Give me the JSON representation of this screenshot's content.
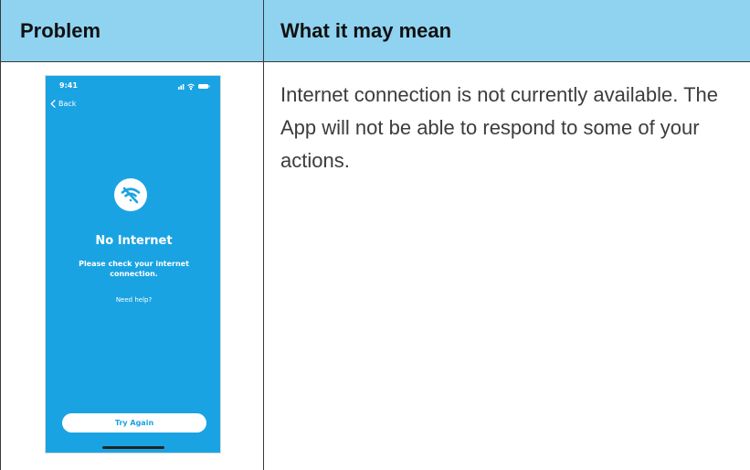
{
  "table": {
    "headers": [
      "Problem",
      "What it may mean"
    ],
    "description": "Internet connection is not currently available. The App will not be able to respond to some of your actions."
  },
  "phone": {
    "status_time": "9:41",
    "back_label": "Back",
    "title": "No Internet",
    "subtitle": "Please check your internet connection.",
    "help_link": "Need help?",
    "button_label": "Try Again",
    "icons": [
      "signal-icon",
      "wifi-icon",
      "battery-icon",
      "chevron-left-icon",
      "wifi-off-icon"
    ],
    "colors": {
      "screen_bg": "#1aa3e2",
      "header_bg": "#8fd3f1",
      "text": "#ffffff"
    }
  }
}
